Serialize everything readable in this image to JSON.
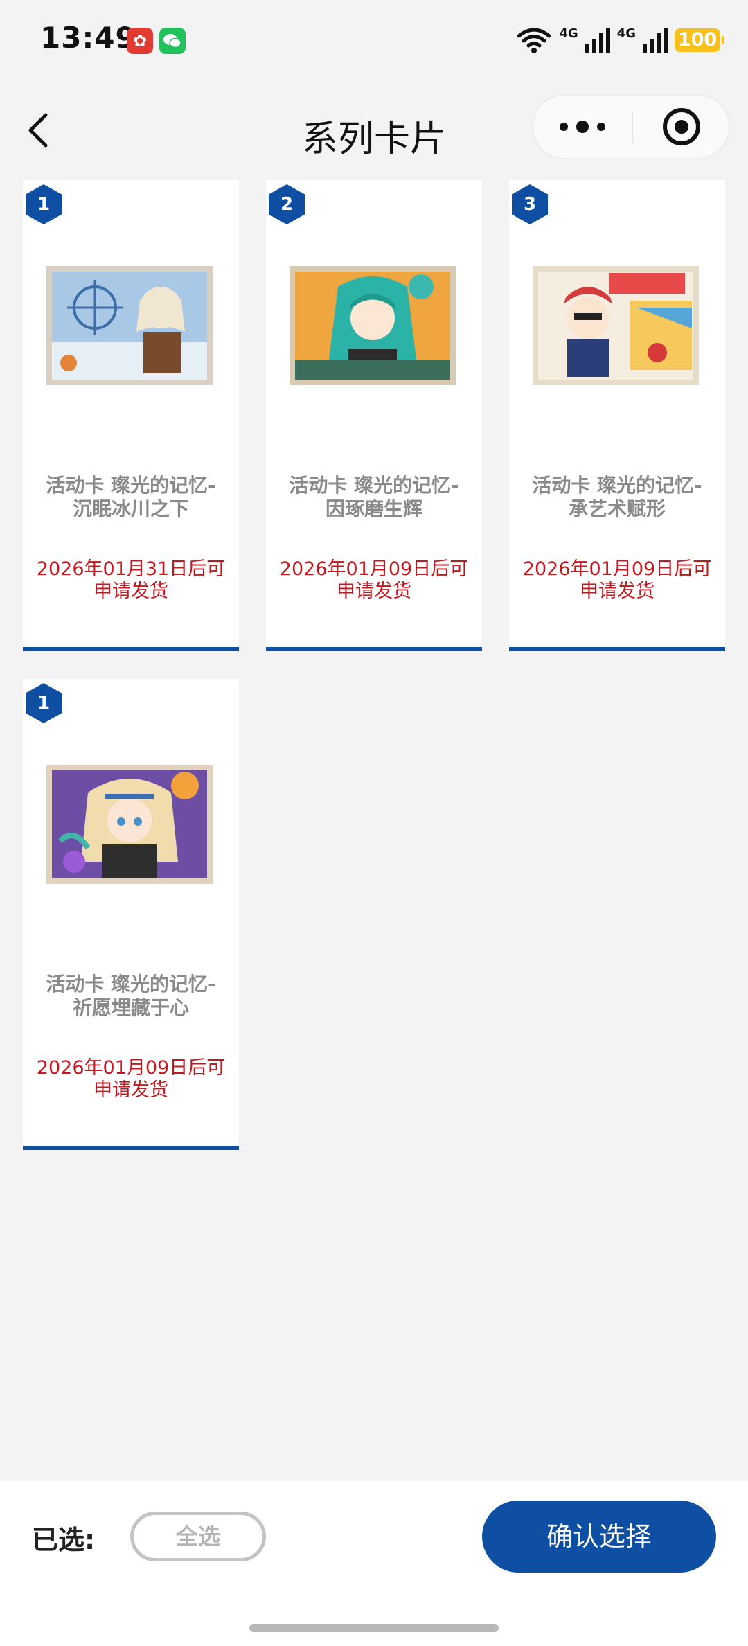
{
  "status_bar": {
    "time": "13:49",
    "network_1": "4G",
    "network_2": "4G",
    "battery": "100",
    "icons": [
      "app-notification-icon",
      "wechat-icon",
      "wifi-icon",
      "signal-icon",
      "signal-icon",
      "battery-icon"
    ]
  },
  "nav": {
    "title": "系列卡片",
    "icons": [
      "back-arrow-icon",
      "more-icon",
      "close-circle-icon"
    ]
  },
  "cards": [
    {
      "badge": "1",
      "name_line1": "活动卡 璨光的记忆-",
      "name_line2": "沉眠冰川之下",
      "date_line1": "2026年01月31日后可",
      "date_line2": "申请发货"
    },
    {
      "badge": "2",
      "name_line1": "活动卡 璨光的记忆-",
      "name_line2": "因琢磨生辉",
      "date_line1": "2026年01月09日后可",
      "date_line2": "申请发货"
    },
    {
      "badge": "3",
      "name_line1": "活动卡 璨光的记忆-",
      "name_line2": "承艺术赋形",
      "date_line1": "2026年01月09日后可",
      "date_line2": "申请发货"
    },
    {
      "badge": "1",
      "name_line1": "活动卡 璨光的记忆-",
      "name_line2": "祈愿埋藏于心",
      "date_line1": "2026年01月09日后可",
      "date_line2": "申请发货"
    }
  ],
  "bottom": {
    "selected_label": "已选:",
    "select_all": "全选",
    "confirm": "确认选择"
  },
  "colors": {
    "accent": "#0f4fa3",
    "date_red": "#c8161d",
    "battery": "#f7c01a"
  }
}
